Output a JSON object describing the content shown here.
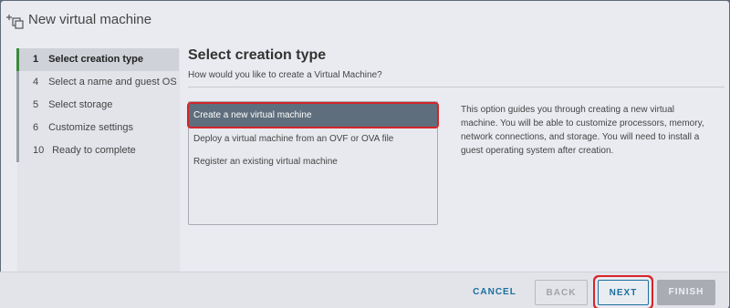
{
  "window": {
    "title": "New virtual machine",
    "icon": "new-vm-icon"
  },
  "steps": [
    {
      "num": "1",
      "label": "Select creation type",
      "active": true
    },
    {
      "num": "4",
      "label": "Select a name and guest OS",
      "active": false
    },
    {
      "num": "5",
      "label": "Select storage",
      "active": false
    },
    {
      "num": "6",
      "label": "Customize settings",
      "active": false
    },
    {
      "num": "10",
      "label": "Ready to complete",
      "active": false
    }
  ],
  "main": {
    "title": "Select creation type",
    "subtitle": "How would you like to create a Virtual Machine?",
    "options": [
      {
        "label": "Create a new virtual machine",
        "selected": true
      },
      {
        "label": "Deploy a virtual machine from an OVF or OVA file",
        "selected": false
      },
      {
        "label": "Register an existing virtual machine",
        "selected": false
      }
    ],
    "description": "This option guides you through creating a new virtual machine. You will be able to customize processors, memory, network connections, and storage. You will need to install a guest operating system after creation."
  },
  "footer": {
    "cancel": "CANCEL",
    "back": "BACK",
    "next": "NEXT",
    "finish": "FINISH"
  },
  "colors": {
    "accent": "#1b6f9e",
    "selected_bg": "#5e6e7c",
    "highlight": "#d6242a",
    "active_step": "#3c8a3c"
  }
}
